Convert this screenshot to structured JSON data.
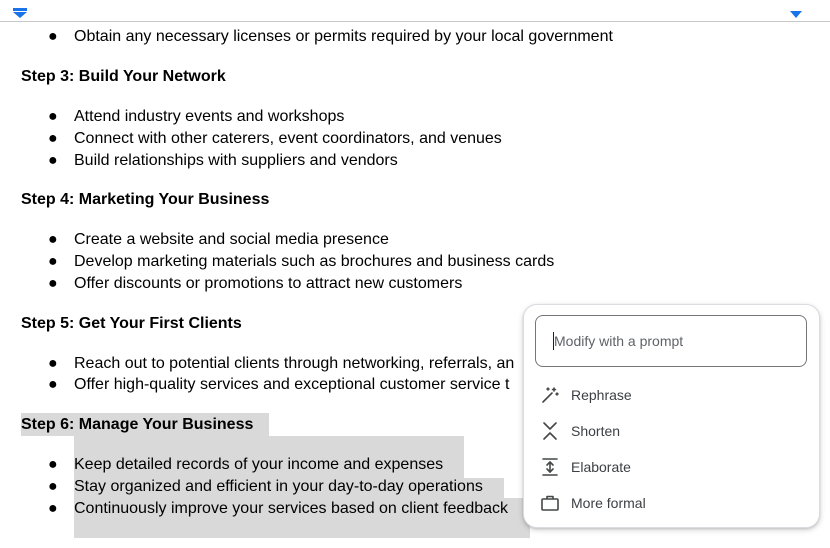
{
  "document": {
    "partial_top_line": "Obtain any necessary licenses or permits required by your local government",
    "sections": [
      {
        "heading": "Step 3: Build Your Network",
        "bullets": [
          "Attend industry events and workshops",
          "Connect with other caterers, event coordinators, and venues",
          "Build relationships with suppliers and vendors"
        ]
      },
      {
        "heading": "Step 4: Marketing Your Business",
        "bullets": [
          "Create a website and social media presence",
          "Develop marketing materials such as brochures and business cards",
          "Offer discounts or promotions to attract new customers"
        ]
      },
      {
        "heading": "Step 5: Get Your First Clients",
        "bullets": [
          "Reach out to potential clients through networking, referrals, an",
          "Offer high-quality services and exceptional customer service t"
        ]
      },
      {
        "heading": "Step 6: Manage Your Business",
        "selected": true,
        "bullets": [
          "Keep detailed records of your income and expenses",
          "Stay organized and efficient in your day-to-day operations",
          "Continuously improve your services based on client feedback"
        ]
      }
    ],
    "bullet_glyph": "●"
  },
  "ai_popup": {
    "prompt_placeholder": "Modify with a prompt",
    "prompt_value": "",
    "options": [
      {
        "label": "Rephrase",
        "icon": "magic-wand-icon"
      },
      {
        "label": "Shorten",
        "icon": "shorten-icon"
      },
      {
        "label": "Elaborate",
        "icon": "elaborate-icon"
      },
      {
        "label": "More formal",
        "icon": "briefcase-icon"
      }
    ]
  },
  "colors": {
    "selection": "#d9d9d9",
    "accent": "#1a73e8"
  }
}
